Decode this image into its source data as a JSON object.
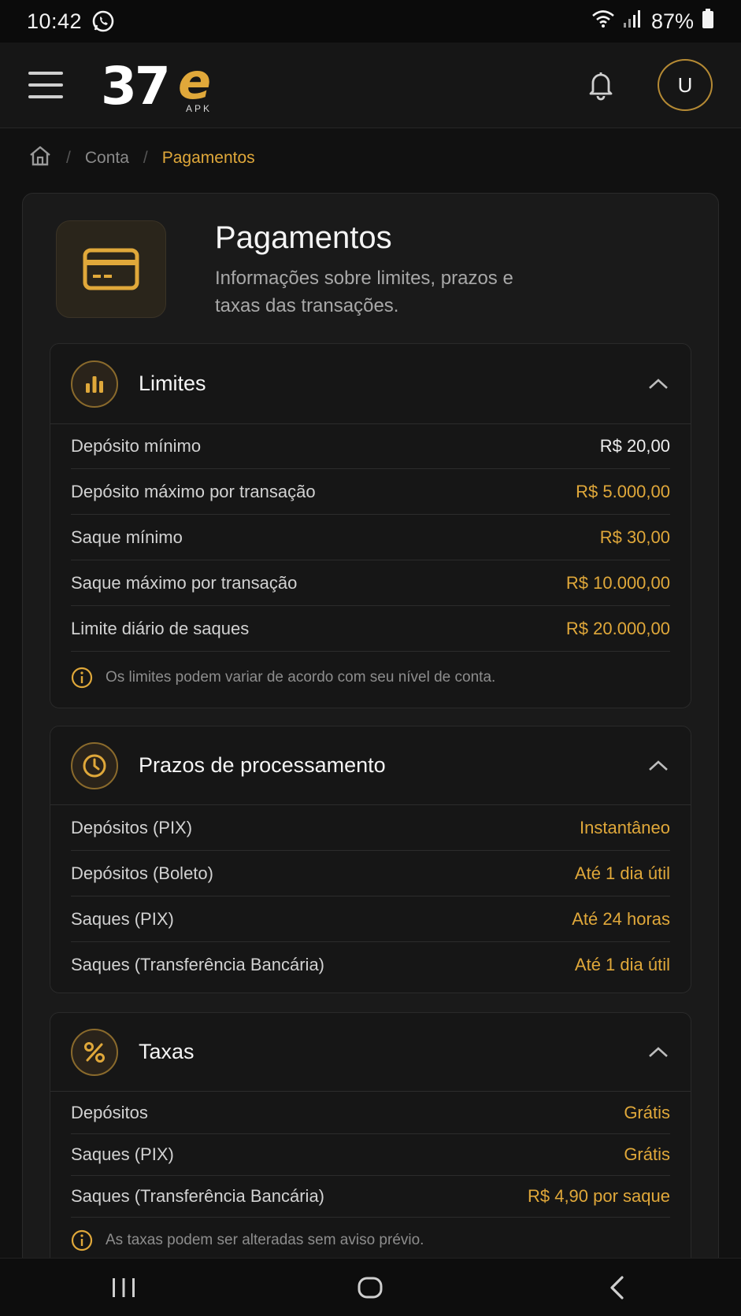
{
  "status_bar": {
    "time": "10:42",
    "battery": "87%",
    "icons": [
      "whatsapp-icon",
      "wifi-icon",
      "signal-icon",
      "battery-icon"
    ]
  },
  "app_bar": {
    "logo_number": "37",
    "logo_letter": "e",
    "logo_sub": "APK",
    "avatar_initial": "U",
    "accent_color": "#e0a83a"
  },
  "breadcrumb": {
    "items": [
      "Conta",
      "Pagamentos"
    ],
    "separator": "/"
  },
  "page": {
    "title": "Pagamentos",
    "subtitle": "Informações sobre limites, prazos e taxas das transações."
  },
  "sections": {
    "limites": {
      "title": "Limites",
      "rows": [
        {
          "label": "Depósito mínimo",
          "value": "R$ 20,00"
        },
        {
          "label": "Depósito máximo por transação",
          "value": "R$ 5.000,00"
        },
        {
          "label": "Saque mínimo",
          "value": "R$ 30,00"
        },
        {
          "label": "Saque máximo por transação",
          "value": "R$ 10.000,00"
        },
        {
          "label": "Limite diário de saques",
          "value": "R$ 20.000,00"
        }
      ],
      "note": "Os limites podem variar de acordo com seu nível de conta."
    },
    "prazos": {
      "title": "Prazos de processamento",
      "rows": [
        {
          "label": "Depósitos (PIX)",
          "value": "Instantâneo"
        },
        {
          "label": "Depósitos (Boleto)",
          "value": "Até 1 dia útil"
        },
        {
          "label": "Saques (PIX)",
          "value": "Até 24 horas"
        },
        {
          "label": "Saques (Transferência Bancária)",
          "value": "Até 1 dia útil"
        }
      ]
    },
    "taxas": {
      "title": "Taxas",
      "rows": [
        {
          "label": "Depósitos",
          "value": "Grátis"
        },
        {
          "label": "Saques (PIX)",
          "value": "Grátis"
        },
        {
          "label": "Saques (Transferência Bancária)",
          "value": "R$ 4,90 por saque"
        }
      ],
      "note": "As taxas podem ser alteradas sem aviso prévio."
    }
  }
}
